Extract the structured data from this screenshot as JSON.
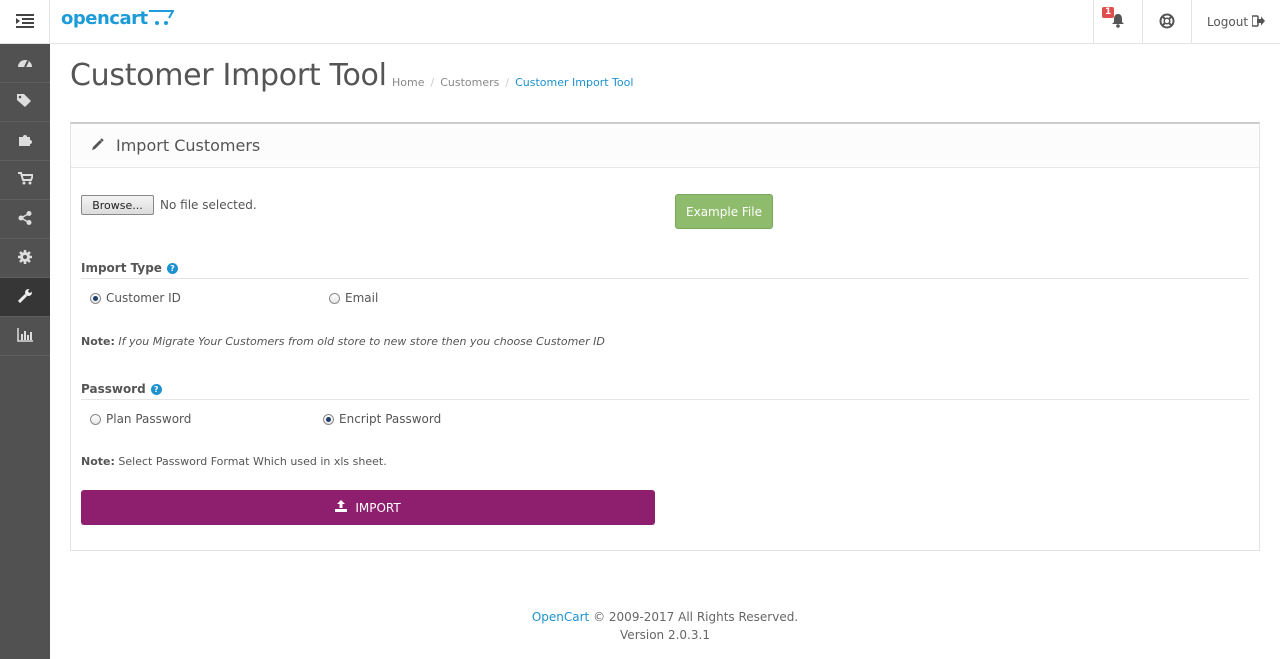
{
  "header": {
    "logo_text": "opencart",
    "notification_count": "1",
    "logout_label": "Logout"
  },
  "sidebar": {
    "items": [
      {
        "icon": "dashboard-icon"
      },
      {
        "icon": "tags-icon"
      },
      {
        "icon": "puzzle-icon"
      },
      {
        "icon": "shopping-cart-icon"
      },
      {
        "icon": "share-icon"
      },
      {
        "icon": "gear-icon"
      },
      {
        "icon": "wrench-icon",
        "active": true
      },
      {
        "icon": "bar-chart-icon"
      }
    ]
  },
  "page": {
    "title": "Customer Import Tool",
    "breadcrumb": [
      "Home",
      "Customers",
      "Customer Import Tool"
    ]
  },
  "panel": {
    "title": "Import Customers",
    "browse_label": "Browse...",
    "file_status": "No file selected.",
    "example_label": "Example File",
    "import_type": {
      "label": "Import Type",
      "options": [
        {
          "label": "Customer ID",
          "checked": true
        },
        {
          "label": "Email",
          "checked": false
        }
      ],
      "note_label": "Note:",
      "note_text": "If you Migrate Your Customers from old store to new store then you choose Customer ID"
    },
    "password": {
      "label": "Password",
      "options": [
        {
          "label": "Plan Password",
          "checked": false
        },
        {
          "label": "Encript Password",
          "checked": true
        }
      ],
      "note_label": "Note:",
      "note_text": "Select Password Format Which used in xls sheet."
    },
    "import_label": "IMPORT"
  },
  "footer": {
    "link": "OpenCart",
    "copyright": "© 2009-2017 All Rights Reserved.",
    "version": "Version 2.0.3.1"
  },
  "colors": {
    "accent": "#1e91cf",
    "import_button": "#8e1e6e",
    "example_button": "#8fbb6c",
    "sidebar": "#515151"
  }
}
